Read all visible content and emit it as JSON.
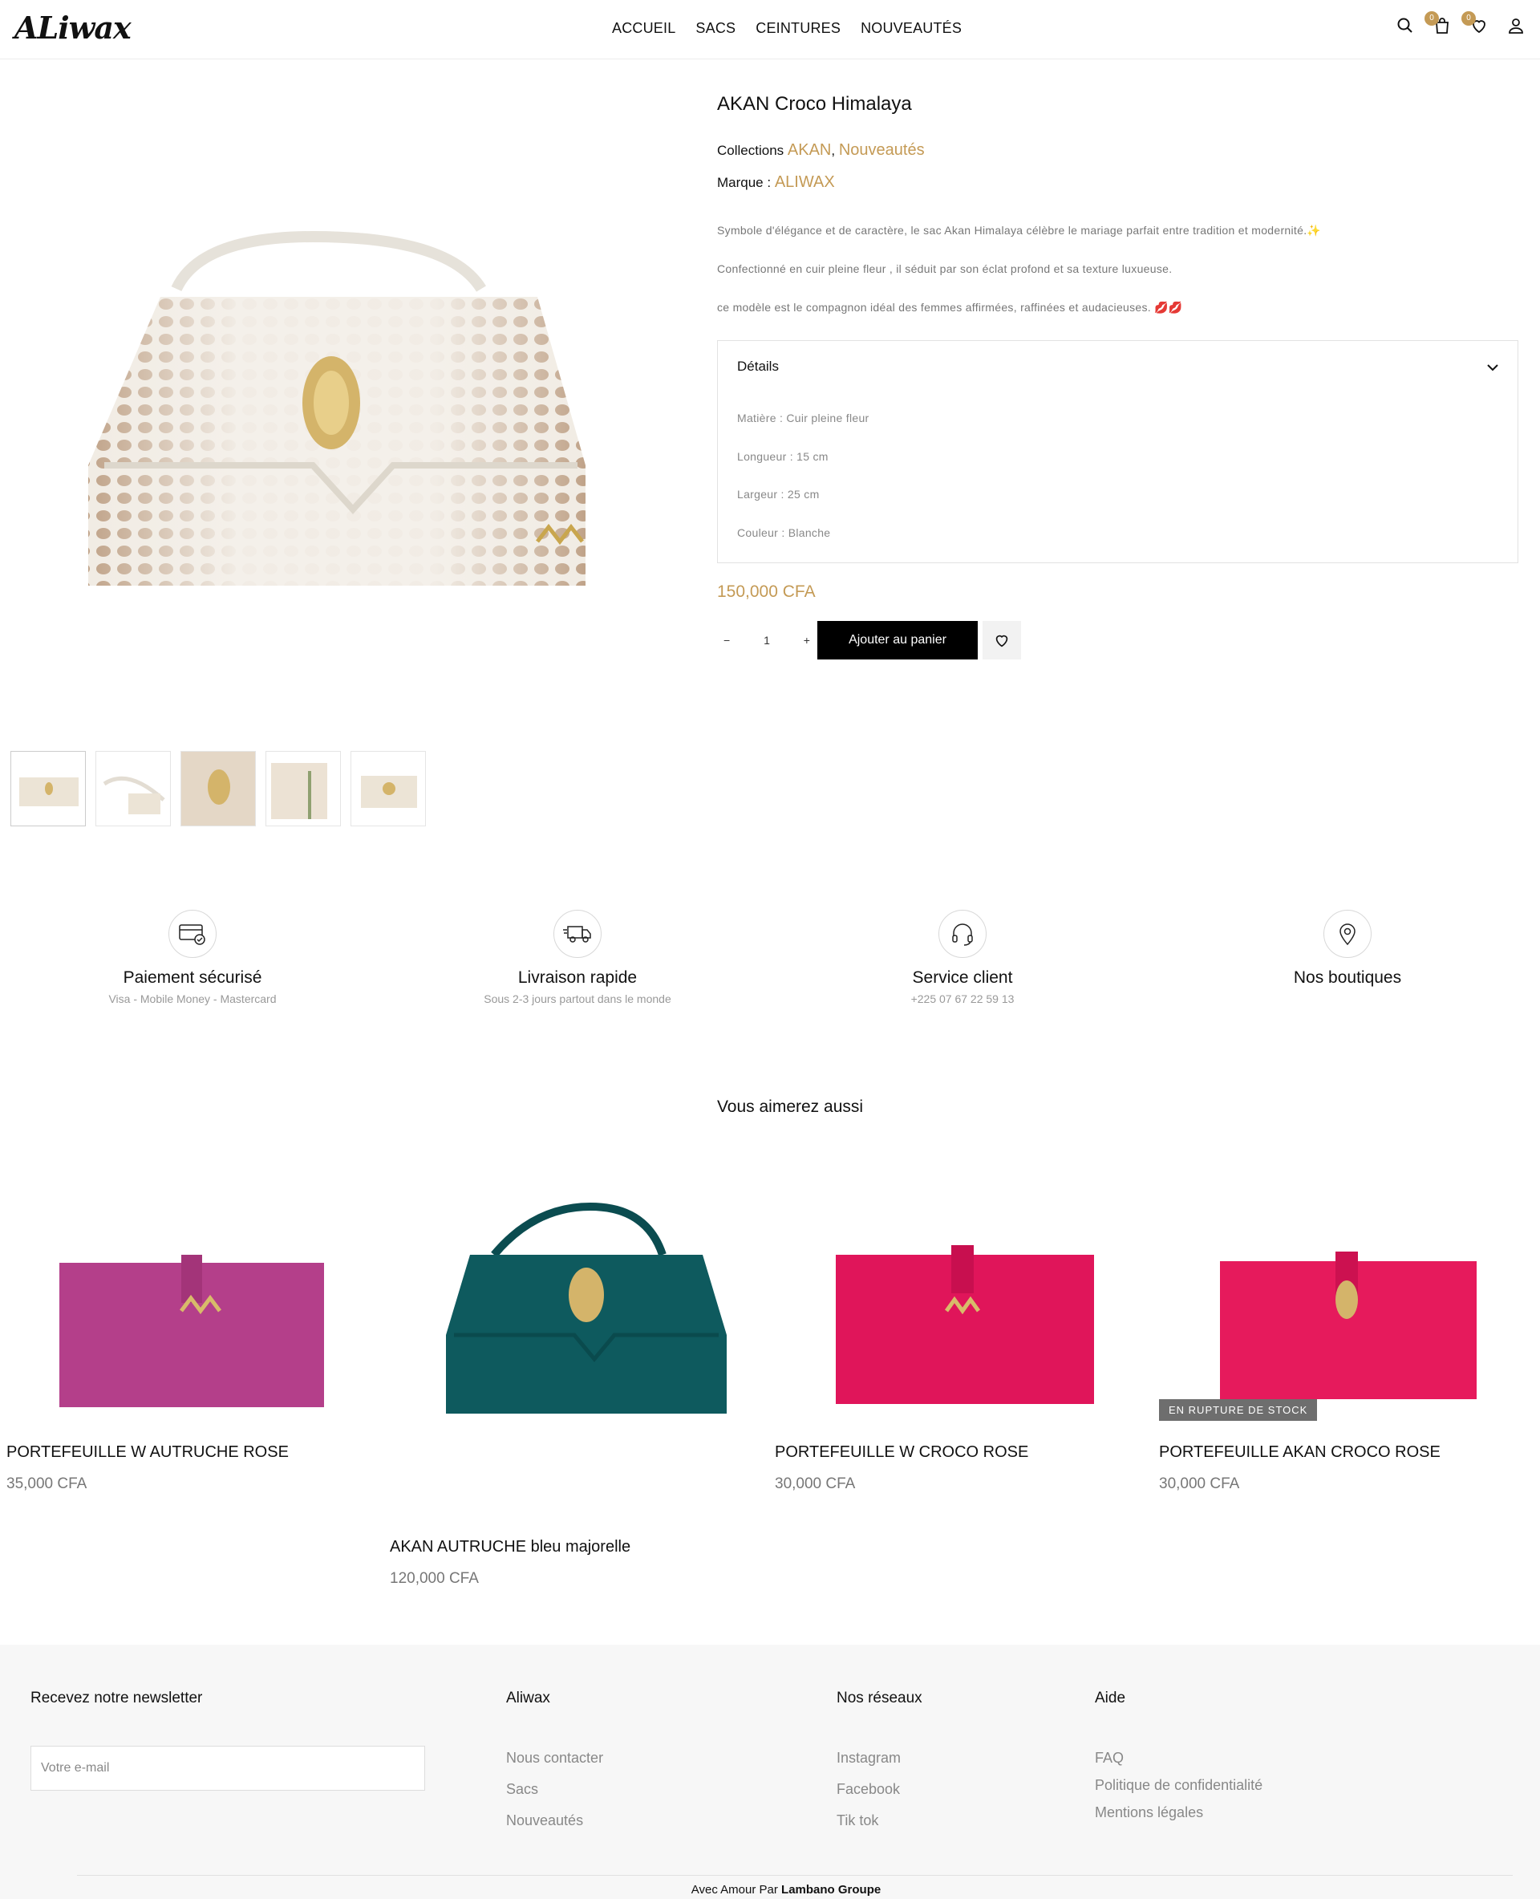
{
  "header": {
    "logo": "ALiwax",
    "nav": [
      "ACCUEIL",
      "SACS",
      "CEINTURES",
      "NOUVEAUTÉS"
    ],
    "cart_count": "0",
    "wishlist_count": "0",
    "icons": [
      "search-icon",
      "cart-icon",
      "heart-icon",
      "user-icon"
    ]
  },
  "product": {
    "title": "AKAN Croco Himalaya",
    "collections_label": "Collections",
    "collection_1": "AKAN",
    "collection_sep": ",",
    "collection_2": "Nouveautés",
    "brand_label": "Marque :",
    "brand": "ALIWAX",
    "desc_1": "Symbole d'élégance et de caractère, le sac Akan Himalaya célèbre le mariage parfait entre tradition et modernité.✨",
    "desc_2": "Confectionné en cuir pleine fleur , il séduit par son éclat profond et sa texture luxueuse.",
    "desc_3": "ce modèle est le compagnon idéal des femmes affirmées, raffinées et audacieuses. 💋💋",
    "details_title": "Détails",
    "specs": [
      "Matière : Cuir pleine fleur",
      "Longueur : 15 cm",
      "Largeur : 25 cm",
      "Couleur : Blanche"
    ],
    "price": "150,000 CFA",
    "qty_minus": "−",
    "qty_value": "1",
    "qty_plus": "+",
    "add_to_cart": "Ajouter au panier"
  },
  "features": [
    {
      "title": "Paiement sécurisé",
      "sub": "Visa - Mobile Money - Mastercard",
      "icon": "card-shield-icon"
    },
    {
      "title": "Livraison rapide",
      "sub": "Sous 2-3 jours partout dans le monde",
      "icon": "truck-icon"
    },
    {
      "title": "Service client",
      "sub": "+225 07 67 22 59 13",
      "icon": "headset-icon"
    },
    {
      "title": "Nos boutiques",
      "sub": "",
      "icon": "map-pin-icon"
    }
  ],
  "related": {
    "heading": "Vous aimerez aussi",
    "items": [
      {
        "name": "PORTEFEUILLE W AUTRUCHE ROSE",
        "price": "35,000 CFA",
        "color": "#b43f8a"
      },
      {
        "name": "AKAN AUTRUCHE bleu majorelle",
        "price": "120,000 CFA",
        "color": "#0e5a5e"
      },
      {
        "name": "PORTEFEUILLE W CROCO ROSE",
        "price": "30,000 CFA",
        "color": "#e0155a"
      },
      {
        "name": "PORTEFEUILLE AKAN CROCO ROSE",
        "price": "30,000 CFA",
        "color": "#e61a5c"
      }
    ],
    "out_of_stock": "EN RUPTURE DE STOCK"
  },
  "footer": {
    "newsletter_title": "Recevez notre newsletter",
    "email_placeholder": "Votre e-mail",
    "col_aliwax_title": "Aliwax",
    "col_aliwax_links": [
      "Nous contacter",
      "Sacs",
      "Nouveautés"
    ],
    "col_social_title": "Nos réseaux",
    "col_social_links": [
      "Instagram",
      "Facebook",
      "Tik tok"
    ],
    "col_help_title": "Aide",
    "col_help_links": [
      "FAQ",
      "Politique de confidentialité",
      "Mentions légales"
    ],
    "credit_prefix": "Avec Amour Par",
    "credit_brand": "Lambano Groupe"
  },
  "colors": {
    "accent": "#c49a55",
    "button": "#000000"
  }
}
